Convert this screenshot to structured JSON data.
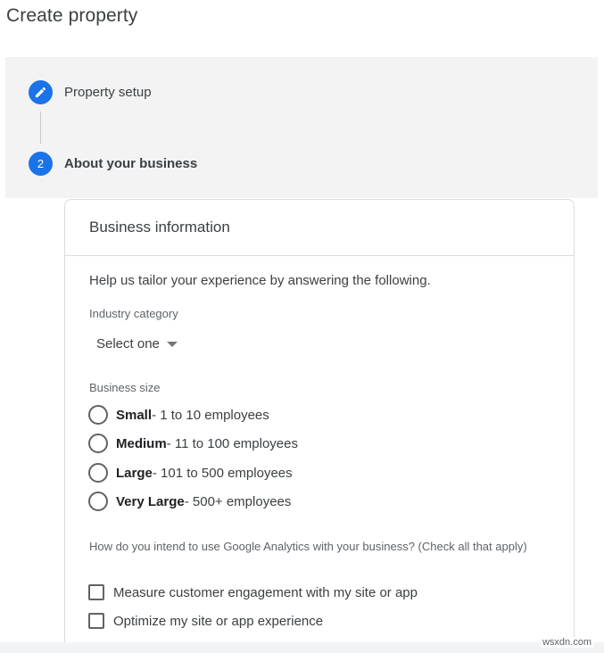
{
  "page": {
    "title": "Create property"
  },
  "stepper": {
    "steps": [
      {
        "number": "",
        "label": "Property setup"
      },
      {
        "number": "2",
        "label": "About your business"
      }
    ]
  },
  "card": {
    "title": "Business information",
    "intro": "Help us tailor your experience by answering the following.",
    "industry": {
      "label": "Industry category",
      "selected": "Select one"
    },
    "business_size": {
      "label": "Business size",
      "options": [
        {
          "name": "Small",
          "detail": " - 1 to 10 employees"
        },
        {
          "name": "Medium",
          "detail": " - 11 to 100 employees"
        },
        {
          "name": "Large",
          "detail": " - 101 to 500 employees"
        },
        {
          "name": "Very Large",
          "detail": " - 500+ employees"
        }
      ]
    },
    "usage": {
      "question": "How do you intend to use Google Analytics with your business? (Check all that apply)",
      "options": [
        "Measure customer engagement with my site or app",
        "Optimize my site or app experience"
      ]
    }
  },
  "watermark": "wsxdn.com",
  "colors": {
    "accent": "#1a73e8",
    "stepper_bg": "#f3f3f3",
    "border": "#dadce0"
  },
  "icons": {
    "step_1": "pencil-icon",
    "industry_select": "caret-down-icon"
  }
}
